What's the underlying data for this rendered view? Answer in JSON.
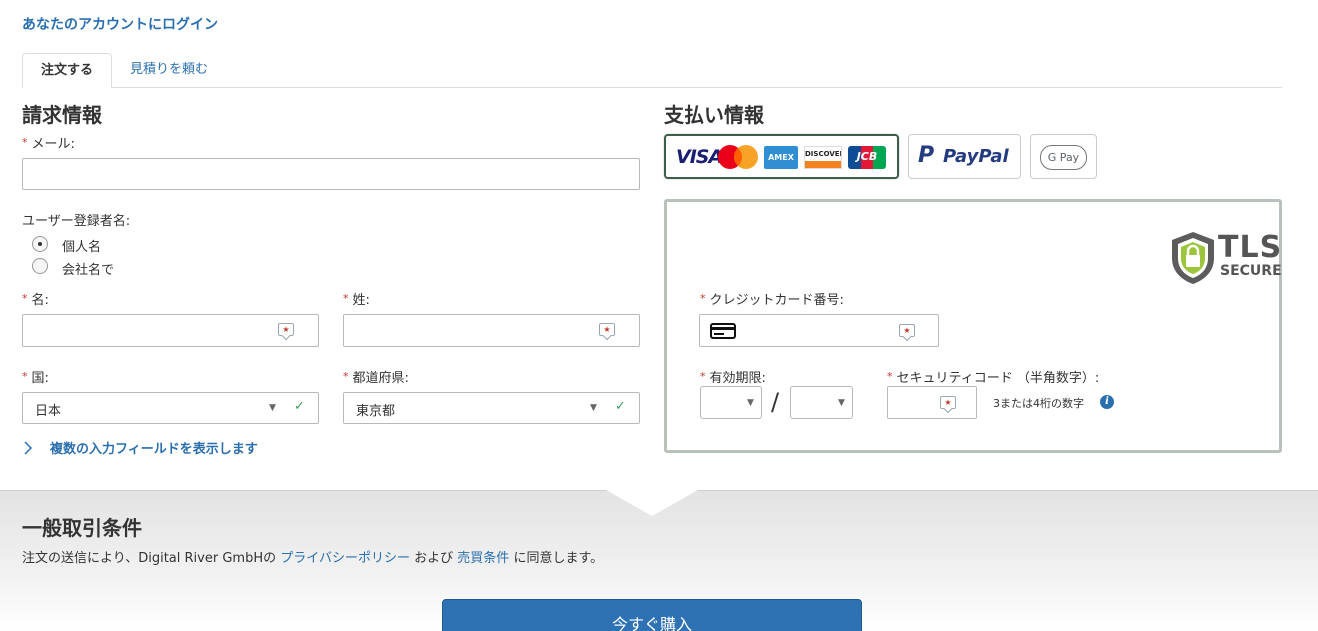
{
  "login_link": "あなたのアカウントにログイン",
  "tabs": [
    {
      "label": "注文する",
      "active": true
    },
    {
      "label": "見積りを頼む",
      "active": false
    }
  ],
  "billing": {
    "title": "請求情報",
    "email_label": "メール:",
    "email_value": "",
    "registrant_label": "ユーザー登録者名:",
    "radio_options": [
      {
        "label": "個人名",
        "checked": true
      },
      {
        "label": "会社名で",
        "checked": false
      }
    ],
    "first_name_label": "名:",
    "last_name_label": "姓:",
    "country_label": "国:",
    "country_value": "日本",
    "prefecture_label": "都道府県:",
    "prefecture_value": "東京都",
    "more_fields": "複数の入力フィールドを表示します",
    "required_mark": "*"
  },
  "payment": {
    "title": "支払い情報",
    "methods": [
      {
        "name": "credit-cards",
        "brands": [
          "VISA",
          "Mastercard",
          "AMEX",
          "DISCOVER",
          "JCB"
        ],
        "selected": true
      },
      {
        "name": "paypal",
        "label": "PayPal"
      },
      {
        "name": "google-pay",
        "label": "G Pay"
      }
    ],
    "tls_badge": {
      "line1": "TLS",
      "line2": "SECURE"
    },
    "card_number_label": "クレジットカード番号:",
    "expiry_label": "有効期限:",
    "expiry_separator": "/",
    "security_code_label": "セキュリティコード （半角数字）:",
    "security_code_hint": "3または4桁の数字",
    "info_icon": "i"
  },
  "terms": {
    "title": "一般取引条件",
    "text_before": "注文の送信により、Digital River GmbHの",
    "privacy_link": "プライバシーポリシー",
    "text_middle": "および",
    "terms_link": "売買条件",
    "text_after": "に同意します。"
  },
  "buy_button": "今すぐ購入",
  "colors": {
    "link": "#2a6fae",
    "required": "#c0392b",
    "buy_button": "#2f72b4",
    "valid_check": "#3aa15a",
    "selected_border": "#3c5f4a"
  }
}
